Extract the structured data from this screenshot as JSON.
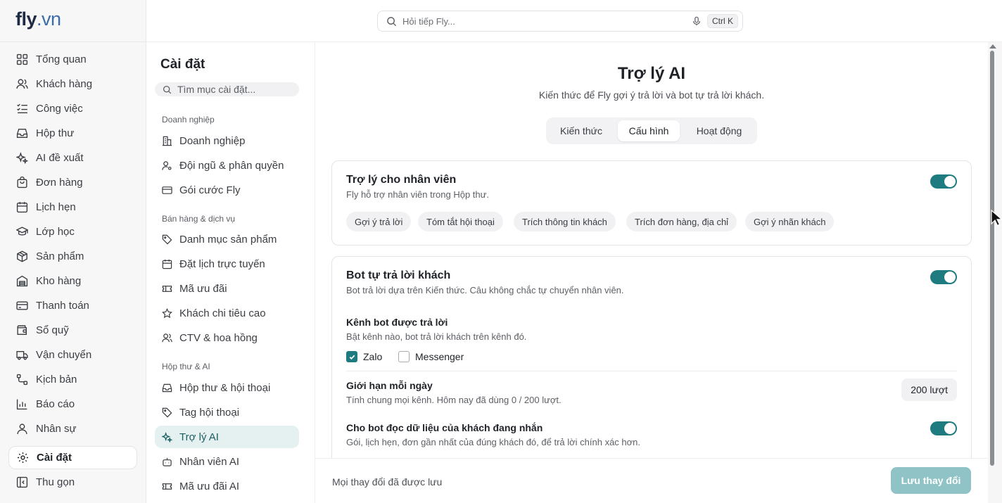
{
  "app": {
    "logo_main": "fly",
    "logo_suffix": ".vn"
  },
  "search": {
    "placeholder": "Hỏi tiếp Fly...",
    "shortcut": "Ctrl K"
  },
  "nav": {
    "items": [
      {
        "label": "Tổng quan",
        "icon": "grid-icon"
      },
      {
        "label": "Khách hàng",
        "icon": "users-icon"
      },
      {
        "label": "Công việc",
        "icon": "tasks-icon"
      },
      {
        "label": "Hộp thư",
        "icon": "inbox-icon"
      },
      {
        "label": "AI đề xuất",
        "icon": "sparkles-icon"
      },
      {
        "label": "Đơn hàng",
        "icon": "shopping-bag-icon"
      },
      {
        "label": "Lịch hẹn",
        "icon": "calendar-icon"
      },
      {
        "label": "Lớp học",
        "icon": "graduation-cap-icon"
      },
      {
        "label": "Sản phẩm",
        "icon": "box-icon"
      },
      {
        "label": "Kho hàng",
        "icon": "warehouse-icon"
      },
      {
        "label": "Thanh toán",
        "icon": "credit-card-icon"
      },
      {
        "label": "Sổ quỹ",
        "icon": "wallet-icon"
      },
      {
        "label": "Vận chuyển",
        "icon": "truck-icon"
      },
      {
        "label": "Kịch bản",
        "icon": "flow-icon"
      },
      {
        "label": "Báo cáo",
        "icon": "bar-chart-icon"
      },
      {
        "label": "Nhân sự",
        "icon": "user-icon"
      }
    ],
    "settings_label": "Cài đặt",
    "collapse_label": "Thu gọn"
  },
  "settings": {
    "title": "Cài đặt",
    "search_placeholder": "Tìm mục cài đặt...",
    "groups": [
      {
        "label": "Doanh nghiệp",
        "items": [
          "Doanh nghiệp",
          "Đội ngũ & phân quyền",
          "Gói cước Fly"
        ]
      },
      {
        "label": "Bán hàng & dịch vụ",
        "items": [
          "Danh mục sản phẩm",
          "Đặt lịch trực tuyến",
          "Mã ưu đãi",
          "Khách chi tiêu cao",
          "CTV & hoa hồng"
        ]
      },
      {
        "label": "Hộp thư & AI",
        "items": [
          "Hộp thư & hội thoại",
          "Tag hội thoại",
          "Trợ lý AI",
          "Nhân viên AI",
          "Mã ưu đãi AI"
        ]
      }
    ],
    "active_item": "Trợ lý AI"
  },
  "main": {
    "title": "Trợ lý AI",
    "subtitle": "Kiến thức để Fly gợi ý trả lời và bot tự trả lời khách.",
    "tabs": [
      "Kiến thức",
      "Cấu hình",
      "Hoạt động"
    ],
    "active_tab": "Cấu hình",
    "staff_card": {
      "title": "Trợ lý cho nhân viên",
      "subtitle": "Fly hỗ trợ nhân viên trong Hộp thư.",
      "enabled": true,
      "chips": [
        "Gợi ý trả lời",
        "Tóm tắt hội thoại",
        "Trích thông tin khách",
        "Trích đơn hàng, địa chỉ",
        "Gợi ý nhãn khách"
      ]
    },
    "bot_card": {
      "title": "Bot tự trả lời khách",
      "subtitle": "Bot trả lời dựa trên Kiến thức. Câu không chắc tự chuyển nhân viên.",
      "enabled": true,
      "channels_title": "Kênh bot được trả lời",
      "channels_subtitle": "Bật kênh nào, bot trả lời khách trên kênh đó.",
      "channels": [
        {
          "label": "Zalo",
          "checked": true
        },
        {
          "label": "Messenger",
          "checked": false
        }
      ],
      "limit_title": "Giới hạn mỗi ngày",
      "limit_subtitle": "Tính chung mọi kênh. Hôm nay đã dùng 0 / 200 lượt.",
      "limit_value": "200 lượt",
      "read_title": "Cho bot đọc dữ liệu của khách đang nhắn",
      "read_subtitle": "Gói, lịch hẹn, đơn gần nhất của đúng khách đó, để trả lời chính xác hơn.",
      "read_enabled": true
    }
  },
  "footer": {
    "status": "Mọi thay đổi đã được lưu",
    "save_label": "Lưu thay đổi"
  },
  "colors": {
    "accent": "#1e7b80",
    "active_bg": "#e5f1f1",
    "save_disabled": "#8fc3c6"
  }
}
